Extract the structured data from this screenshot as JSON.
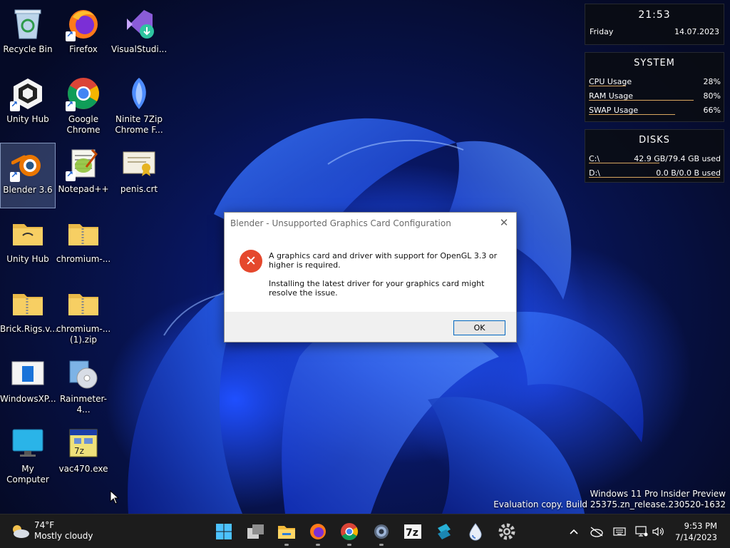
{
  "desktop": {
    "icons": [
      {
        "label": "Recycle Bin"
      },
      {
        "label": "Firefox"
      },
      {
        "label": "VisualStudi..."
      },
      {
        "label": "Unity Hub"
      },
      {
        "label": "Google\nChrome"
      },
      {
        "label": "Ninite 7Zip\nChrome F..."
      },
      {
        "label": "Blender 3.6"
      },
      {
        "label": "Notepad++"
      },
      {
        "label": "penis.crt"
      },
      {
        "label": "Unity Hub"
      },
      {
        "label": "chromium-..."
      },
      {
        "label": "Brick.Rigs.v..."
      },
      {
        "label": "chromium-...\n(1).zip"
      },
      {
        "label": "WindowsXP..."
      },
      {
        "label": "Rainmeter-4..."
      },
      {
        "label": "My Computer"
      },
      {
        "label": "vac470.exe"
      }
    ]
  },
  "clock_widget": {
    "time": "21:53",
    "day": "Friday",
    "date": "14.07.2023"
  },
  "system_widget": {
    "title": "SYSTEM",
    "rows": [
      {
        "label": "CPU Usage",
        "value": "28%",
        "fraction": 0.28
      },
      {
        "label": "RAM Usage",
        "value": "80%",
        "fraction": 0.8
      },
      {
        "label": "SWAP Usage",
        "value": "66%",
        "fraction": 0.66
      }
    ]
  },
  "disks_widget": {
    "title": "DISKS",
    "rows": [
      {
        "label": "C:\\",
        "value": "42.9 GB/79.4 GB used",
        "fraction": 0.54
      },
      {
        "label": "D:\\",
        "value": "0.0 B/0.0 B used",
        "fraction": 1.0
      }
    ]
  },
  "dialog": {
    "title": "Blender - Unsupported Graphics Card Configuration",
    "close": "✕",
    "error_glyph": "✕",
    "message1": "A graphics card and driver with support for OpenGL 3.3 or higher is required.",
    "message2": "Installing the latest driver for your graphics card might resolve the issue.",
    "ok_label": "OK"
  },
  "watermark": {
    "line1": "Windows 11 Pro Insider Preview",
    "line2": "Evaluation copy. Build 25375.zn_release.230520-1632"
  },
  "taskbar": {
    "weather_temp": "74°F",
    "weather_desc": "Mostly cloudy",
    "apps": [
      "start-icon",
      "task-view-icon",
      "file-explorer-icon",
      "firefox-icon",
      "chrome-icon",
      "settings-icon",
      "7zip-icon",
      "app-icon",
      "droplet-icon",
      "gear-icon"
    ],
    "time": "9:53 PM",
    "date": "7/14/2023"
  },
  "colors": {
    "accent": "#0067c0",
    "error": "#e5482d",
    "bar": "#d9a760",
    "taskbar": "#1c1c1c"
  }
}
